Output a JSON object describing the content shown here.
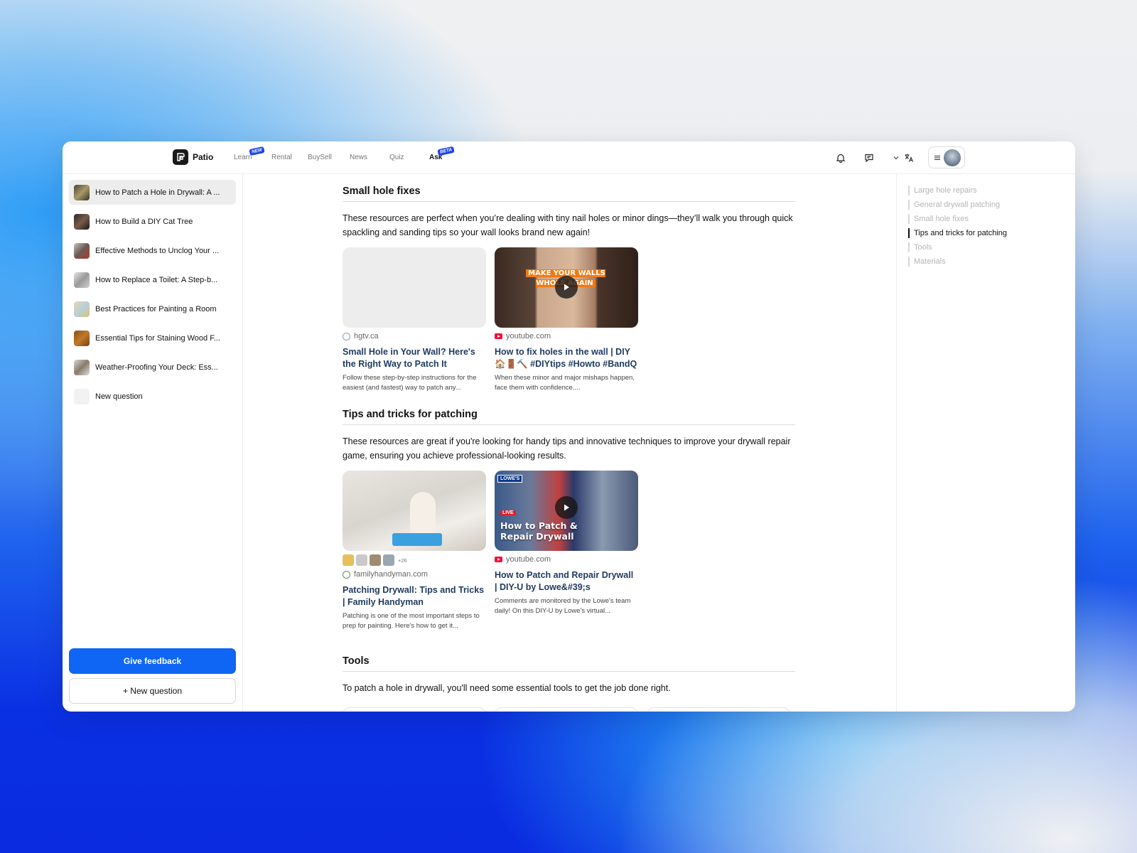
{
  "nav": {
    "brand": "Patio",
    "items": [
      {
        "label": "Learn",
        "tag": "NEW"
      },
      {
        "label": "Rental",
        "tag": ""
      },
      {
        "label": "BuySell",
        "tag": ""
      },
      {
        "label": "News",
        "tag": ""
      },
      {
        "label": "Quiz",
        "tag": ""
      },
      {
        "label": "Ask",
        "tag": "BETA"
      }
    ],
    "icons": [
      "bell-icon",
      "chat-icon",
      "chevron-down-icon",
      "translate-icon",
      "menu-icon"
    ]
  },
  "sidebar": {
    "items": [
      {
        "label": "How to Patch a Hole in Drywall: A ..."
      },
      {
        "label": "How to Build a DIY Cat Tree"
      },
      {
        "label": "Effective Methods to Unclog Your ..."
      },
      {
        "label": "How to Replace a Toilet: A Step-b..."
      },
      {
        "label": "Best Practices for Painting a Room"
      },
      {
        "label": "Essential Tips for Staining Wood F..."
      },
      {
        "label": "Weather-Proofing Your Deck: Ess..."
      },
      {
        "label": "New question"
      }
    ],
    "feedback_label": "Give feedback",
    "new_question_label": "+ New question"
  },
  "main": {
    "sections": [
      {
        "title": "Small hole fixes",
        "text": "These resources are perfect when you’re dealing with tiny nail holes or minor dings—they’ll walk you through quick spackling and sanding tips so your wall looks brand new again!",
        "cards": [
          {
            "source": "hgtv.ca",
            "title": "Small Hole in Your Wall? Here's the Right Way to Patch It",
            "desc": "Follow these step-by-step instructions for the easiest (and fastest) way to patch any..."
          },
          {
            "source": "youtube.com",
            "title": "How to fix holes in the wall | DIY 🏠🚪🔨 #DIYtips #Howto #BandQ",
            "desc": "When these minor and major mishaps happen, face them with confidence....",
            "video_text": "MAKE YOUR WALLS WHOLE AGAIN"
          }
        ]
      },
      {
        "title": "Tips and tricks for patching",
        "text": "These resources are great if you're looking for handy tips and innovative techniques to improve your drywall repair game, ensuring you achieve professional-looking results.",
        "cards": [
          {
            "source": "familyhandyman.com",
            "title": "Patching Drywall: Tips and Tricks | Family Handyman",
            "desc": "Patching is one of the most important steps to prep for painting. Here's how to get it...",
            "more_count": "+26"
          },
          {
            "source": "youtube.com",
            "title": "How to Patch and Repair Drywall | DIY-U by Lowe&#39;s",
            "desc": "Comments are monitored by the Lowe's team daily! On this DIY-U by Lowe's virtual...",
            "video_text": "How to Patch & Repair Drywall",
            "badge": "LOWE'S",
            "live": "LIVE"
          }
        ]
      },
      {
        "title": "Tools",
        "text": "To patch a hole in drywall, you'll need some essential tools to get the job done right."
      }
    ]
  },
  "toc": {
    "items": [
      "Large hole repairs",
      "General drywall patching",
      "Small hole fixes",
      "Tips and tricks for patching",
      "Tools",
      "Materials"
    ],
    "active": "Tips and tricks for patching"
  },
  "colors": {
    "accent": "#0f66f5",
    "tag": "#1d44e6",
    "link_title": "#1f3a5f"
  }
}
